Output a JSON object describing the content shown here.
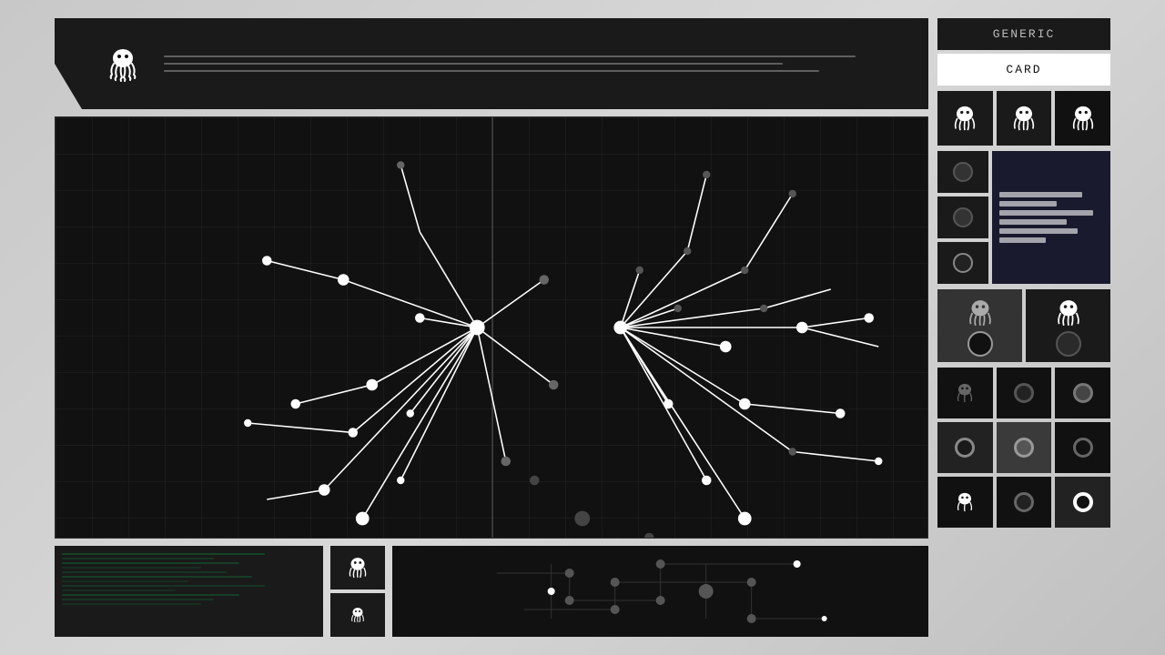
{
  "header": {
    "logo_label": "octopus-logo",
    "line1": "",
    "line2": "",
    "line3": ""
  },
  "right_panel": {
    "btn_generic": "GENERIC",
    "btn_card": "CARD",
    "icons": [
      "octopus",
      "octopus",
      "octopus"
    ]
  },
  "bottom_bar": {
    "left_label": "code-panel",
    "mid_icon1": "octopus-sm",
    "mid_icon2": "octopus-xs"
  },
  "canvas": {
    "label": "circuit-canvas"
  }
}
